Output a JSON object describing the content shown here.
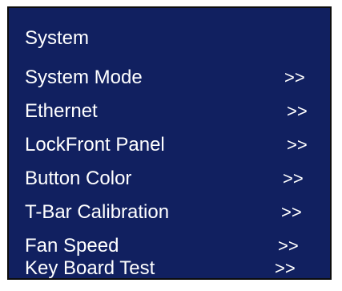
{
  "menu": {
    "title": "System",
    "items": [
      {
        "label": "System Mode",
        "arrow": ">>"
      },
      {
        "label": "Ethernet",
        "arrow": ">>"
      },
      {
        "label": "LockFront Panel",
        "arrow": ">>"
      },
      {
        "label": "Button Color",
        "arrow": ">>"
      },
      {
        "label": "T-Bar Calibration",
        "arrow": ">>"
      },
      {
        "label": "Fan Speed",
        "arrow": ">>"
      },
      {
        "label": "Key Board Test",
        "arrow": ">>"
      }
    ]
  },
  "colors": {
    "panel_background": "#112060",
    "text": "#ffffff",
    "border": "#0c0c0c"
  }
}
